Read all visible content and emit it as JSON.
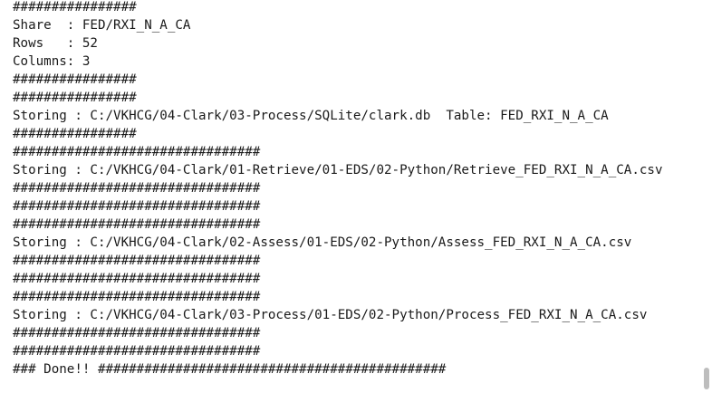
{
  "console": {
    "lines": [
      "################",
      "Share  : FED/RXI_N_A_CA",
      "Rows   : 52",
      "Columns: 3",
      "################",
      "################",
      "Storing : C:/VKHCG/04-Clark/03-Process/SQLite/clark.db  Table: FED_RXI_N_A_CA",
      "################",
      "################################",
      "Storing : C:/VKHCG/04-Clark/01-Retrieve/01-EDS/02-Python/Retrieve_FED_RXI_N_A_CA.csv",
      "################################",
      "################################",
      "################################",
      "Storing : C:/VKHCG/04-Clark/02-Assess/01-EDS/02-Python/Assess_FED_RXI_N_A_CA.csv",
      "################################",
      "################################",
      "################################",
      "Storing : C:/VKHCG/04-Clark/03-Process/01-EDS/02-Python/Process_FED_RXI_N_A_CA.csv",
      "################################",
      "################################",
      "### Done!! #############################################"
    ]
  }
}
